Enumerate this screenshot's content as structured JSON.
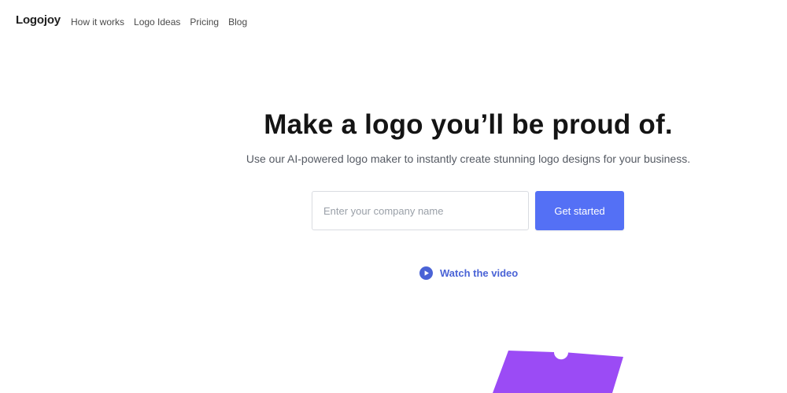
{
  "header": {
    "brand": "Logojoy",
    "nav": [
      {
        "label": "How it works"
      },
      {
        "label": "Logo Ideas"
      },
      {
        "label": "Pricing"
      },
      {
        "label": "Blog"
      }
    ]
  },
  "hero": {
    "title": "Make a logo you’ll be proud of.",
    "subtitle": "Use our AI-powered logo maker to instantly create stunning logo designs for your business."
  },
  "signup": {
    "input_placeholder": "Enter your company name",
    "button_label": "Get started"
  },
  "video": {
    "label": "Watch the video",
    "icon": "play-circle-icon"
  },
  "colors": {
    "accent": "#5470f5",
    "link": "#4a63d6",
    "illustration": "#9b4bf5"
  }
}
